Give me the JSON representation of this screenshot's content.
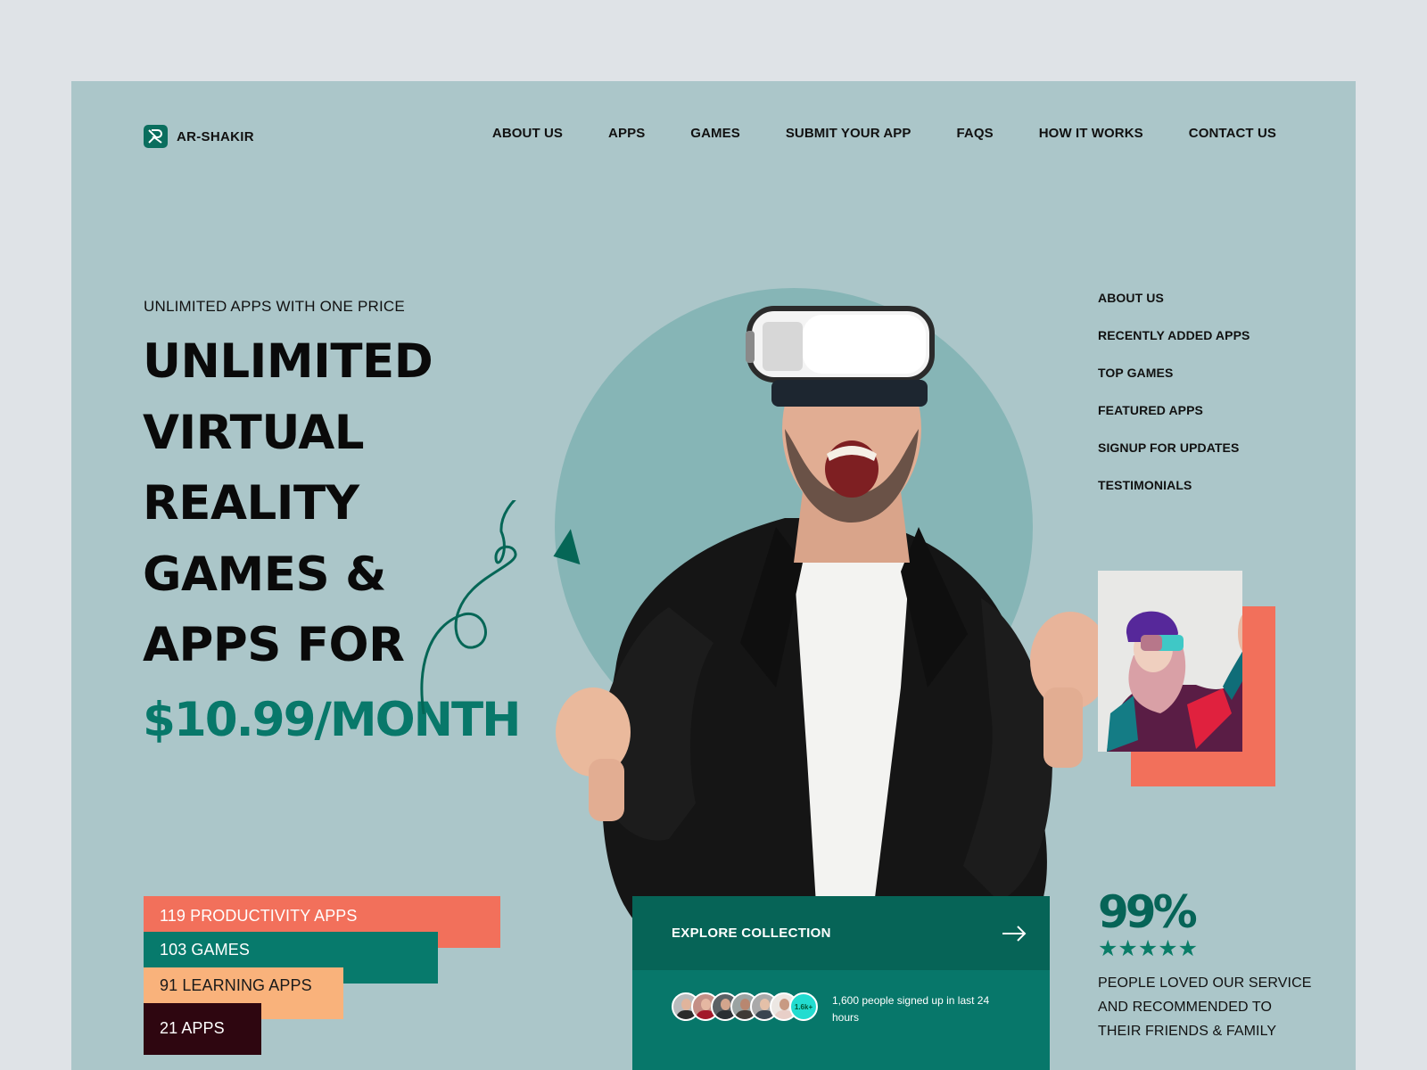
{
  "brand": {
    "name": "AR-SHAKIR",
    "logo_icon": "r-logo-icon"
  },
  "nav": {
    "items": [
      {
        "label": "ABOUT US"
      },
      {
        "label": "APPS"
      },
      {
        "label": "GAMES"
      },
      {
        "label": "SUBMIT YOUR APP"
      },
      {
        "label": "FAQS"
      },
      {
        "label": "HOW IT WORKS"
      },
      {
        "label": "CONTACT US"
      }
    ]
  },
  "hero": {
    "eyebrow": "UNLIMITED APPS WITH ONE PRICE",
    "headline_lines": [
      "UNLIMITED",
      "VIRTUAL",
      "REALITY",
      "GAMES &",
      "APPS FOR"
    ],
    "price": "$10.99/MONTH",
    "image_alt": "Excited man wearing VR headset and leather jacket"
  },
  "side_nav": {
    "items": [
      {
        "label": "ABOUT US"
      },
      {
        "label": "RECENTLY ADDED APPS"
      },
      {
        "label": "TOP GAMES"
      },
      {
        "label": "FEATURED APPS"
      },
      {
        "label": "SIGNUP FOR UPDATES"
      },
      {
        "label": "TESTIMONIALS"
      }
    ]
  },
  "feature_photo": {
    "alt": "Woman in purple beanie with VR visor"
  },
  "stats": [
    {
      "label": "119 PRODUCTIVITY APPS",
      "color": "#f2705b"
    },
    {
      "label": "103 GAMES",
      "color": "#077a6c"
    },
    {
      "label": "91 LEARNING APPS",
      "color": "#f9b27b"
    },
    {
      "label": "21 APPS",
      "color": "#2e0610"
    }
  ],
  "explore": {
    "title": "EXPLORE COLLECTION",
    "arrow_icon": "arrow-right-icon",
    "avatar_count_badge": "1.6k+",
    "signup_text": "1,600 people signed up in last 24 hours"
  },
  "rating": {
    "value": "99%",
    "stars": 5,
    "stars_glyphs": "★★★★★",
    "text": "PEOPLE LOVED OUR SERVICE AND RECOMMENDED TO THEIR FRIENDS & FAMILY"
  },
  "colors": {
    "page_bg": "#dfe3e7",
    "panel_bg": "#abc6c9",
    "circle": "#86b5b6",
    "brand_green": "#066457",
    "accent_green": "#08786a",
    "coral": "#f2705b",
    "peach": "#f9b27b",
    "maroon": "#2e0610",
    "badge_cyan": "#22dcd0"
  }
}
